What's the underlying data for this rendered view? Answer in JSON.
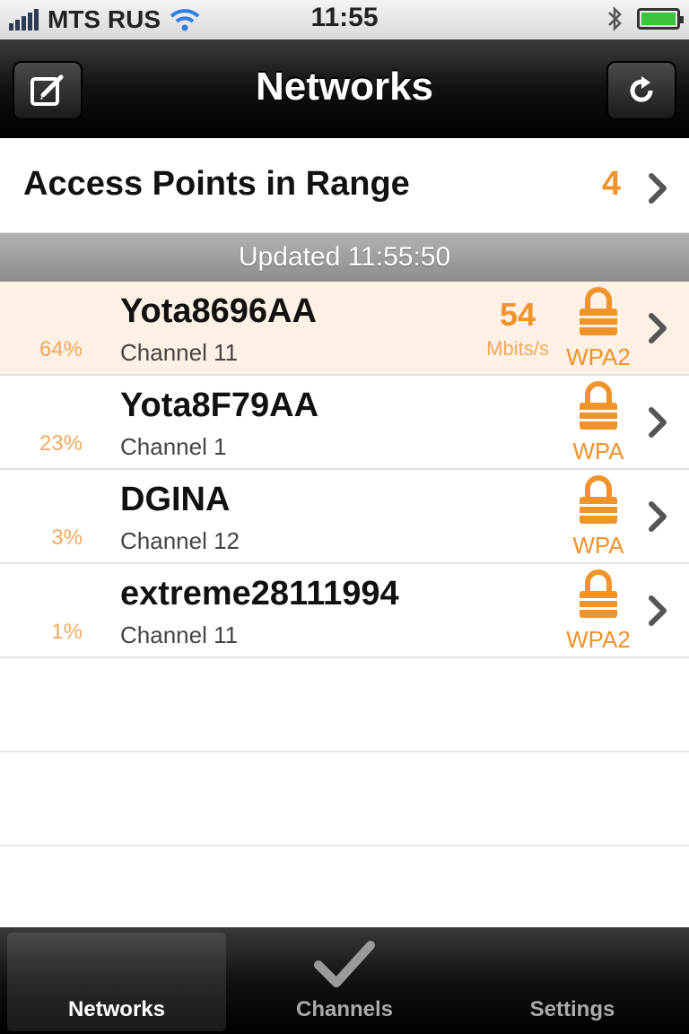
{
  "status_bar": {
    "carrier": "MTS RUS",
    "time": "11:55"
  },
  "nav": {
    "title": "Networks",
    "left_icon": "compose-icon",
    "right_icon": "refresh-icon"
  },
  "access_points": {
    "label": "Access Points in Range",
    "count": "4"
  },
  "section": {
    "updated": "Updated 11:55:50"
  },
  "networks": [
    {
      "ssid": "Yota8696AA",
      "channel": "Channel 11",
      "signal": "64%",
      "speed": "54",
      "speed_unit": "Mbits/s",
      "security": "WPA2",
      "highlighted": true
    },
    {
      "ssid": "Yota8F79AA",
      "channel": "Channel 1",
      "signal": "23%",
      "security": "WPA"
    },
    {
      "ssid": "DGINA",
      "channel": "Channel 12",
      "signal": "3%",
      "security": "WPA"
    },
    {
      "ssid": "extreme28111994",
      "channel": "Channel 11",
      "signal": "1%",
      "security": "WPA2"
    }
  ],
  "tabs": [
    {
      "label": "Networks",
      "icon": "networks-tab-icon",
      "active": true
    },
    {
      "label": "Channels",
      "icon": "checkmark-icon"
    },
    {
      "label": "Settings",
      "icon": "settings-tab-icon"
    }
  ],
  "colors": {
    "accent": "#f0932b",
    "highlight_row": "#fdf0e4",
    "battery": "#3cc43c"
  }
}
